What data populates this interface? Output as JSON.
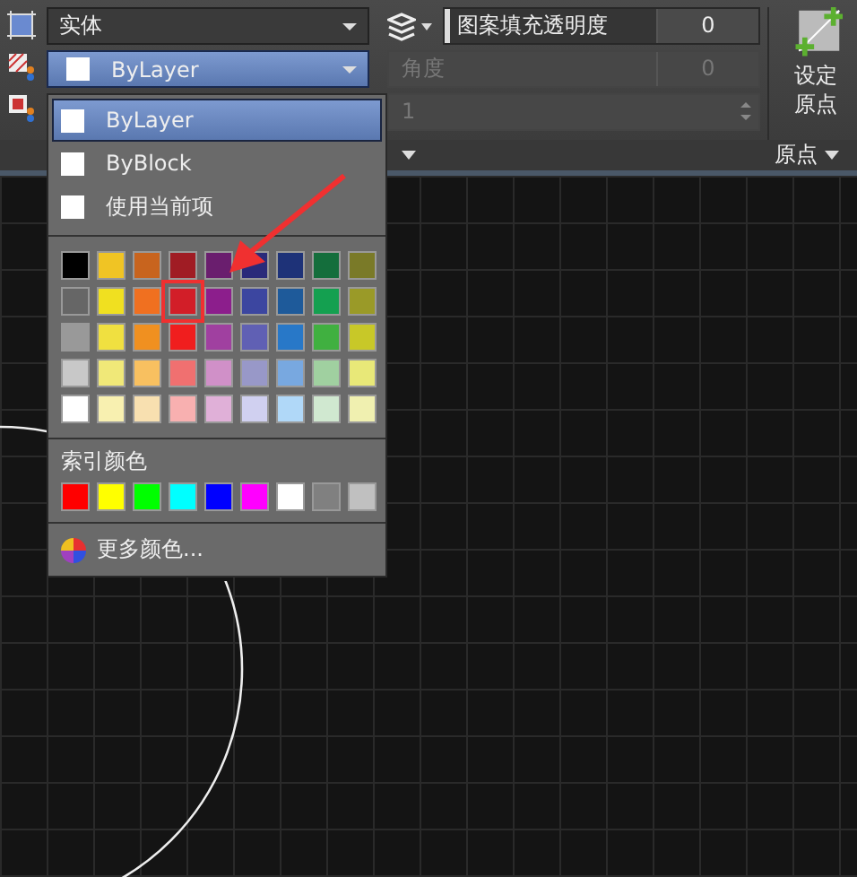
{
  "hatch_panel": {
    "pattern_type": "实体",
    "color_combo": {
      "value": "ByLayer",
      "open": true
    },
    "transparency": {
      "label": "图案填充透明度",
      "value": "0"
    },
    "angle": {
      "label": "角度",
      "value": "0",
      "disabled": true
    },
    "scale": {
      "value": "1",
      "disabled": true
    }
  },
  "origin_panel": {
    "button": "设定原点",
    "footer": "原点"
  },
  "color_menu": {
    "items": [
      {
        "label": "ByLayer",
        "selected": true
      },
      {
        "label": "ByBlock",
        "selected": false
      },
      {
        "label": "使用当前项",
        "selected": false
      }
    ],
    "standard_colors": [
      [
        {
          "color": "#000000",
          "marked": false
        },
        {
          "color": "#f0c424",
          "marked": false
        },
        {
          "color": "#c8641e",
          "marked": false
        },
        {
          "color": "#a01c24",
          "marked": false
        },
        {
          "color": "#6a1e6e",
          "marked": false
        },
        {
          "color": "#2a2a7a",
          "marked": false
        },
        {
          "color": "#1e3278",
          "marked": false
        },
        {
          "color": "#146e3c",
          "marked": false
        },
        {
          "color": "#7a7a28",
          "marked": false
        }
      ],
      [
        {
          "color": "#666666",
          "marked": false
        },
        {
          "color": "#f0e020",
          "marked": false
        },
        {
          "color": "#f07020",
          "marked": false
        },
        {
          "color": "#d21e28",
          "marked": true
        },
        {
          "color": "#8c1e8c",
          "marked": false
        },
        {
          "color": "#3c46a0",
          "marked": false
        },
        {
          "color": "#1e5a9a",
          "marked": false
        },
        {
          "color": "#14a050",
          "marked": false
        },
        {
          "color": "#9a9a28",
          "marked": false
        }
      ],
      [
        {
          "color": "#999999",
          "marked": false
        },
        {
          "color": "#f0e040",
          "marked": false
        },
        {
          "color": "#f09020",
          "marked": false
        },
        {
          "color": "#f01e1e",
          "marked": false
        },
        {
          "color": "#a040a0",
          "marked": false
        },
        {
          "color": "#6060b4",
          "marked": false
        },
        {
          "color": "#2878c8",
          "marked": false
        },
        {
          "color": "#40b040",
          "marked": false
        },
        {
          "color": "#c8c828",
          "marked": false
        }
      ],
      [
        {
          "color": "#c8c8c8",
          "marked": false
        },
        {
          "color": "#f0e878",
          "marked": false
        },
        {
          "color": "#f8c060",
          "marked": false
        },
        {
          "color": "#f07070",
          "marked": false
        },
        {
          "color": "#d090c8",
          "marked": false
        },
        {
          "color": "#9898c8",
          "marked": false
        },
        {
          "color": "#78a8e0",
          "marked": false
        },
        {
          "color": "#a0d0a0",
          "marked": false
        },
        {
          "color": "#e8e878",
          "marked": false
        }
      ],
      [
        {
          "color": "#ffffff",
          "marked": false
        },
        {
          "color": "#f8f0b0",
          "marked": false
        },
        {
          "color": "#f8e0b0",
          "marked": false
        },
        {
          "color": "#f8b0b0",
          "marked": false
        },
        {
          "color": "#e0b0d8",
          "marked": false
        },
        {
          "color": "#d0d0f0",
          "marked": false
        },
        {
          "color": "#b0d8f8",
          "marked": false
        },
        {
          "color": "#d0e8d0",
          "marked": false
        },
        {
          "color": "#f0f0b0",
          "marked": false
        }
      ]
    ],
    "index_title": "索引颜色",
    "index_colors": [
      {
        "color": "#ff0000"
      },
      {
        "color": "#ffff00"
      },
      {
        "color": "#00ff00"
      },
      {
        "color": "#00ffff"
      },
      {
        "color": "#0000ff"
      },
      {
        "color": "#ff00ff"
      },
      {
        "color": "#ffffff"
      },
      {
        "color": "#808080"
      },
      {
        "color": "#c0c0c0"
      }
    ],
    "more": "更多颜色..."
  }
}
